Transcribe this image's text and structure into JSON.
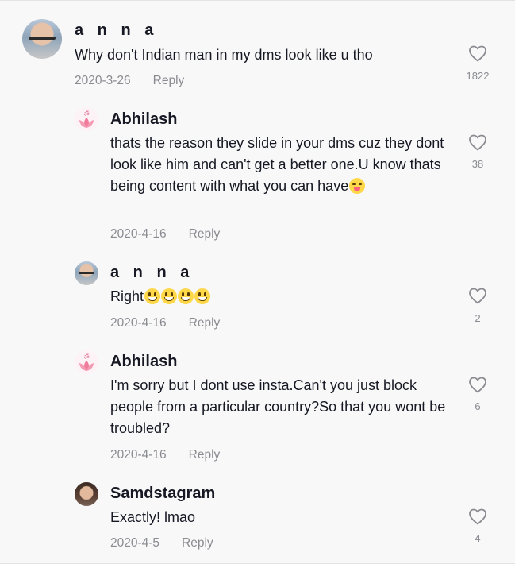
{
  "comments": [
    {
      "user": "a n n a",
      "text": "Why don't Indian man in my dms look like u tho",
      "date": "2020-3-26",
      "reply_label": "Reply",
      "likes": "1822"
    },
    {
      "user": "Abhilash",
      "text": "thats the reason they slide in your dms cuz they dont look like him and can't get a better one.U know thats being content with what you can have",
      "date": "2020-4-16",
      "reply_label": "Reply",
      "likes": "38"
    },
    {
      "user": "a n n a",
      "text": "Right",
      "date": "2020-4-16",
      "reply_label": "Reply",
      "likes": "2"
    },
    {
      "user": "Abhilash",
      "text": "I'm sorry but I dont use insta.Can't you just block people from a particular country?So that you wont be troubled?",
      "date": "2020-4-16",
      "reply_label": "Reply",
      "likes": "6"
    },
    {
      "user": "Samdstagram",
      "text": "Exactly! lmao",
      "date": "2020-4-5",
      "reply_label": "Reply",
      "likes": "4"
    }
  ],
  "icons": {
    "like": "heart-outline-icon",
    "lotus": "lotus-icon",
    "emoji_smile": "grinning-face-emoji",
    "emoji_tongue": "squinting-tongue-emoji"
  },
  "colors": {
    "background": "#f8f8f8",
    "text": "#161823",
    "muted": "#8a8b91"
  }
}
